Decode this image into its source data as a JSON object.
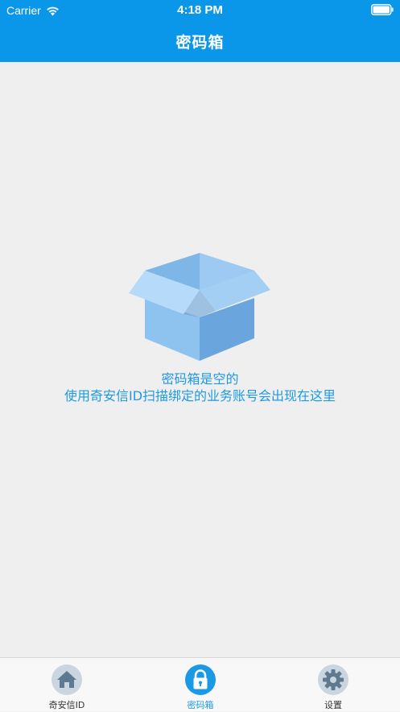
{
  "status_bar": {
    "carrier": "Carrier",
    "time": "4:18 PM"
  },
  "header": {
    "title": "密码箱"
  },
  "empty_state": {
    "line1": "密码箱是空的",
    "line2": "使用奇安信ID扫描绑定的业务账号会出现在这里",
    "icon": "open-box-icon"
  },
  "tabs": [
    {
      "label": "奇安信ID",
      "icon": "home-icon",
      "active": false
    },
    {
      "label": "密码箱",
      "icon": "lock-icon",
      "active": true
    },
    {
      "label": "设置",
      "icon": "gear-icon",
      "active": false
    }
  ],
  "colors": {
    "header": "#0a97ea",
    "accent_text": "#1f9ae0",
    "background": "#efefef",
    "tab_active": "#1a9ae4",
    "tab_inactive_icon": "#c7d3dd"
  }
}
